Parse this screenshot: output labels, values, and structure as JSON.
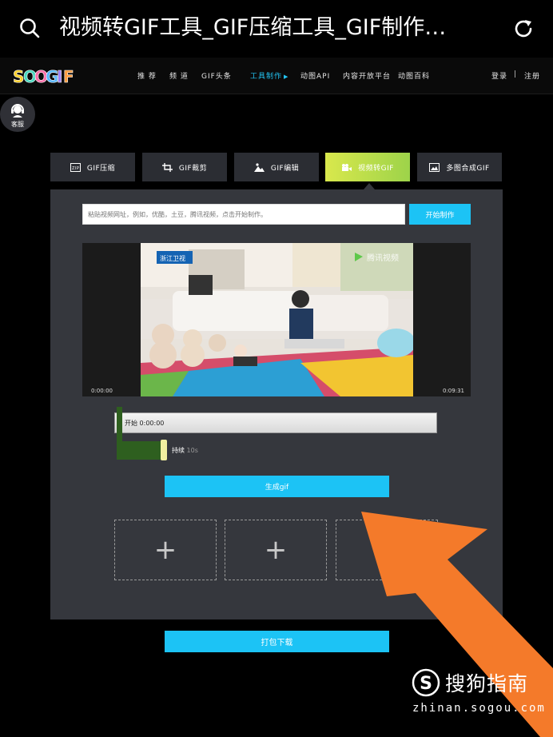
{
  "browser": {
    "title": "视频转GIF工具_GIF压缩工具_GIF制作…",
    "search_icon": "search-icon",
    "reload_icon": "reload-icon"
  },
  "site": {
    "logo_text": "SOOGIF",
    "nav": [
      "推 荐",
      "频 道",
      "GIF头条",
      "工具制作",
      "动图API",
      "内容开放平台",
      "动图百科"
    ],
    "active_nav": "工具制作",
    "login": "登录",
    "separator": "|",
    "register": "注册",
    "customer_service": "客服"
  },
  "tabs": [
    {
      "label": "GIF压缩",
      "icon": "zip-icon"
    },
    {
      "label": "GIF裁剪",
      "icon": "crop-icon"
    },
    {
      "label": "GIF编辑",
      "icon": "image-edit-icon"
    },
    {
      "label": "视频转GIF",
      "icon": "video-camera-icon",
      "active": true
    },
    {
      "label": "多图合成GIF",
      "icon": "images-icon"
    }
  ],
  "tool": {
    "url_placeholder": "粘贴视频网址，例如，优酷，土豆，腾讯视频，点击开始制作。",
    "start_button": "开始制作",
    "video_overlay_left": "浙江卫视",
    "video_overlay_right": "腾讯视频",
    "time_start": "0:00:00",
    "time_end": "0:09:31",
    "range_label": "开始 0:00:00",
    "duration_label": "持续",
    "duration_value": "10s",
    "generate_button": "生成gif",
    "slots": [
      "+",
      "+",
      "+"
    ],
    "download_button": "打包下载"
  },
  "watermark": {
    "text": "搜狗指南",
    "url": "zhinan.sogou.com"
  },
  "colors": {
    "accent": "#1cc3f5",
    "active_tab": "#c7e04a",
    "panel": "#35373d",
    "arrow": "#f47a2a"
  }
}
